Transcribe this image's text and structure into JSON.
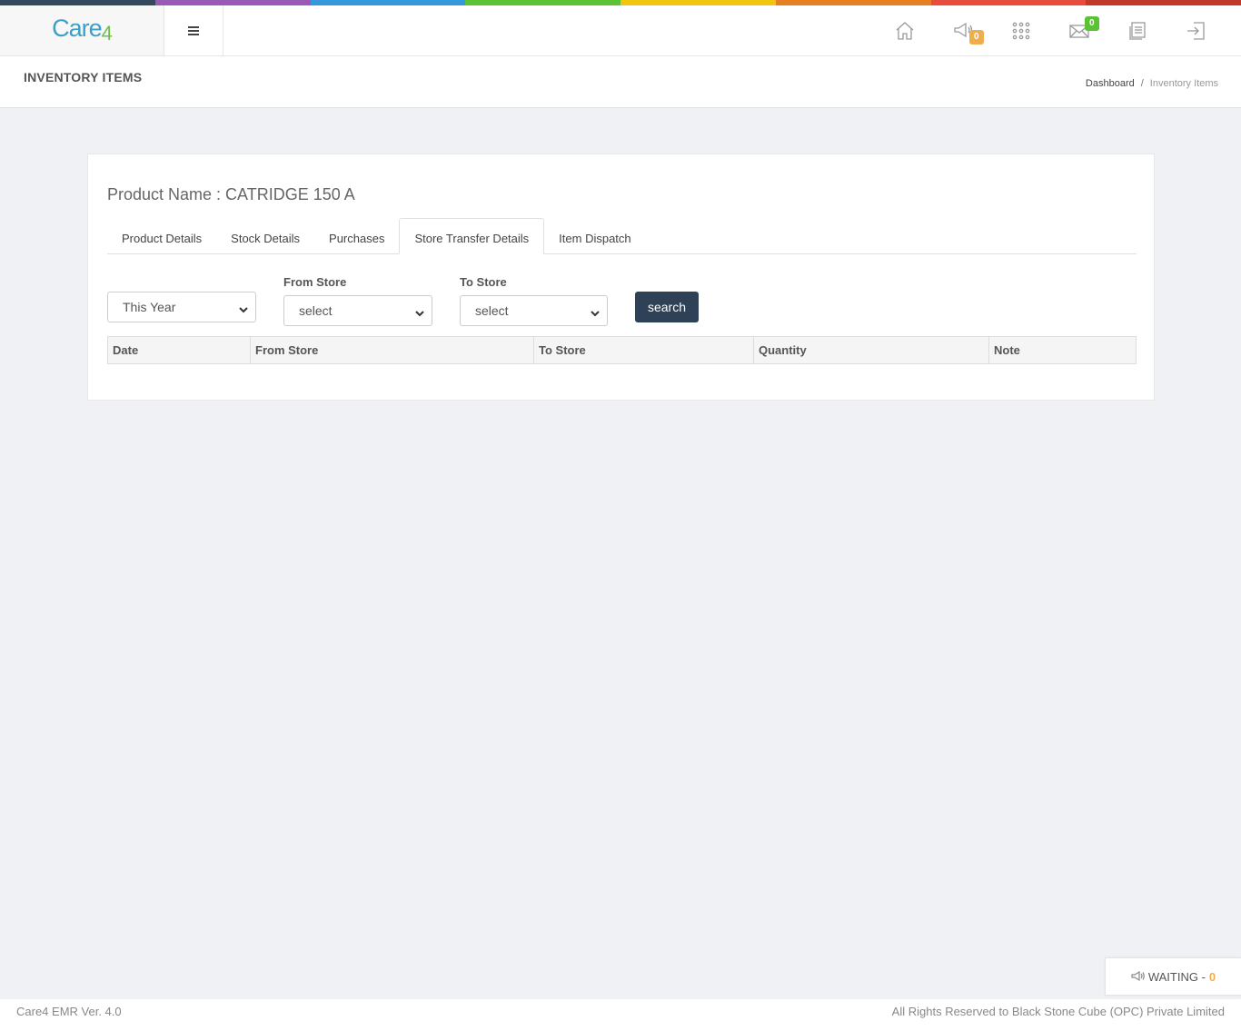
{
  "brand": {
    "name": "Care",
    "suffix": "4",
    "colors": [
      "#34495e",
      "#9b59b6",
      "#3498db",
      "#5bc236",
      "#f1c40f",
      "#e67e22",
      "#e74c3c",
      "#c0392b"
    ]
  },
  "header": {
    "icons": [
      {
        "name": "home-icon"
      },
      {
        "name": "announcement-icon",
        "badge": "0"
      },
      {
        "name": "apps-grid-icon"
      },
      {
        "name": "mail-icon",
        "badge": "0"
      },
      {
        "name": "document-icon"
      },
      {
        "name": "logout-icon"
      }
    ]
  },
  "page": {
    "title": "INVENTORY ITEMS",
    "breadcrumb": {
      "home": "Dashboard",
      "separator": "/",
      "current": "Inventory Items"
    }
  },
  "product": {
    "label": "Product Name : CATRIDGE 150 A"
  },
  "tabs": [
    {
      "label": "Product Details"
    },
    {
      "label": "Stock Details"
    },
    {
      "label": "Purchases"
    },
    {
      "label": "Store Transfer Details",
      "active": true
    },
    {
      "label": "Item Dispatch"
    }
  ],
  "filters": {
    "period": {
      "value": "This Year"
    },
    "from_store": {
      "label": "From Store",
      "value": "select"
    },
    "to_store": {
      "label": "To Store",
      "value": "select"
    },
    "search_label": "search"
  },
  "table": {
    "columns": [
      "Date",
      "From Store",
      "To Store",
      "Quantity",
      "Note"
    ]
  },
  "waiting": {
    "label": "WAITING -",
    "count": "0"
  },
  "footer": {
    "version": "Care4 EMR Ver. 4.0",
    "copyright": "All Rights Reserved to Black Stone Cube (OPC) Private Limited"
  }
}
